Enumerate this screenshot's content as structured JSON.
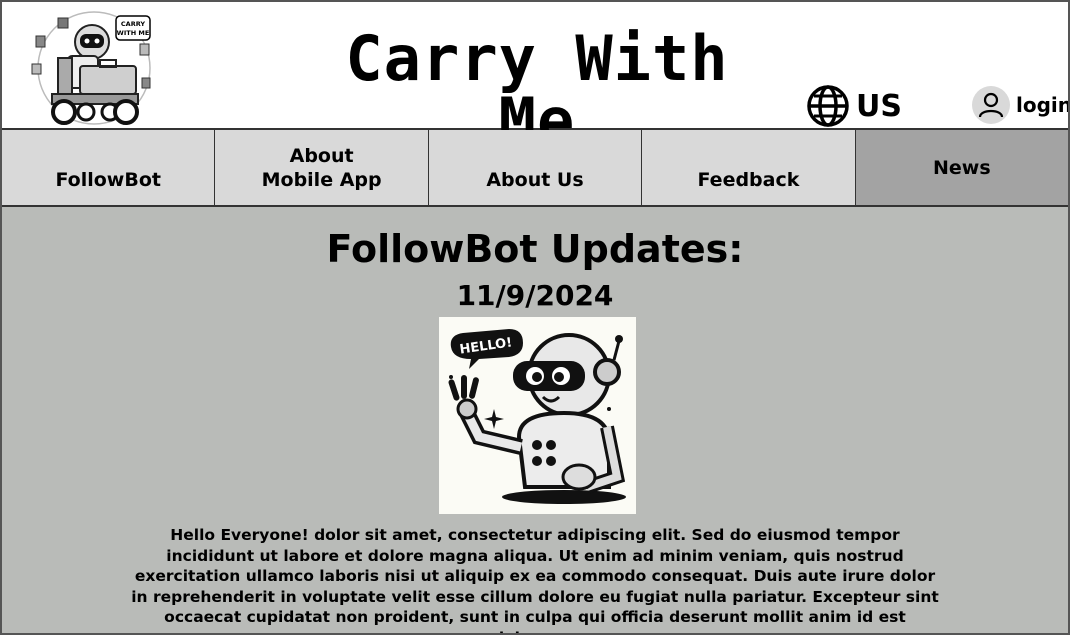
{
  "header": {
    "logo_text_line1": "CARRY",
    "logo_text_line2": "WITH ME",
    "title": "Carry With Me",
    "language_label": "US",
    "login_label": "login"
  },
  "nav": {
    "items": [
      {
        "label": "FollowBot"
      },
      {
        "label": "About Mobile App"
      },
      {
        "label": "About Us"
      },
      {
        "label": "Feedback"
      },
      {
        "label": "News"
      }
    ],
    "active": "News"
  },
  "main": {
    "heading": "FollowBot Updates:",
    "date": "11/9/2024",
    "image_speech_text": "HELLO!",
    "body": "Hello Everyone! dolor sit amet, consectetur adipiscing elit. Sed do eiusmod tempor incididunt ut labore et dolore magna aliqua. Ut enim ad minim veniam, quis nostrud exercitation ullamco laboris nisi ut aliquip ex ea commodo consequat. Duis aute irure dolor in reprehenderit in voluptate velit esse cillum dolore eu fugiat nulla pariatur. Excepteur sint occaecat cupidatat non proident, sunt in culpa qui officia deserunt mollit anim id est laborum"
  },
  "icons": {
    "language": "globe-icon",
    "login": "user-icon",
    "logo": "robot-logo"
  },
  "colors": {
    "page_bg": "#b9bbb8",
    "nav_bg": "#d9d9d9",
    "nav_active_bg": "#a3a3a3",
    "header_bg": "#ffffff"
  }
}
